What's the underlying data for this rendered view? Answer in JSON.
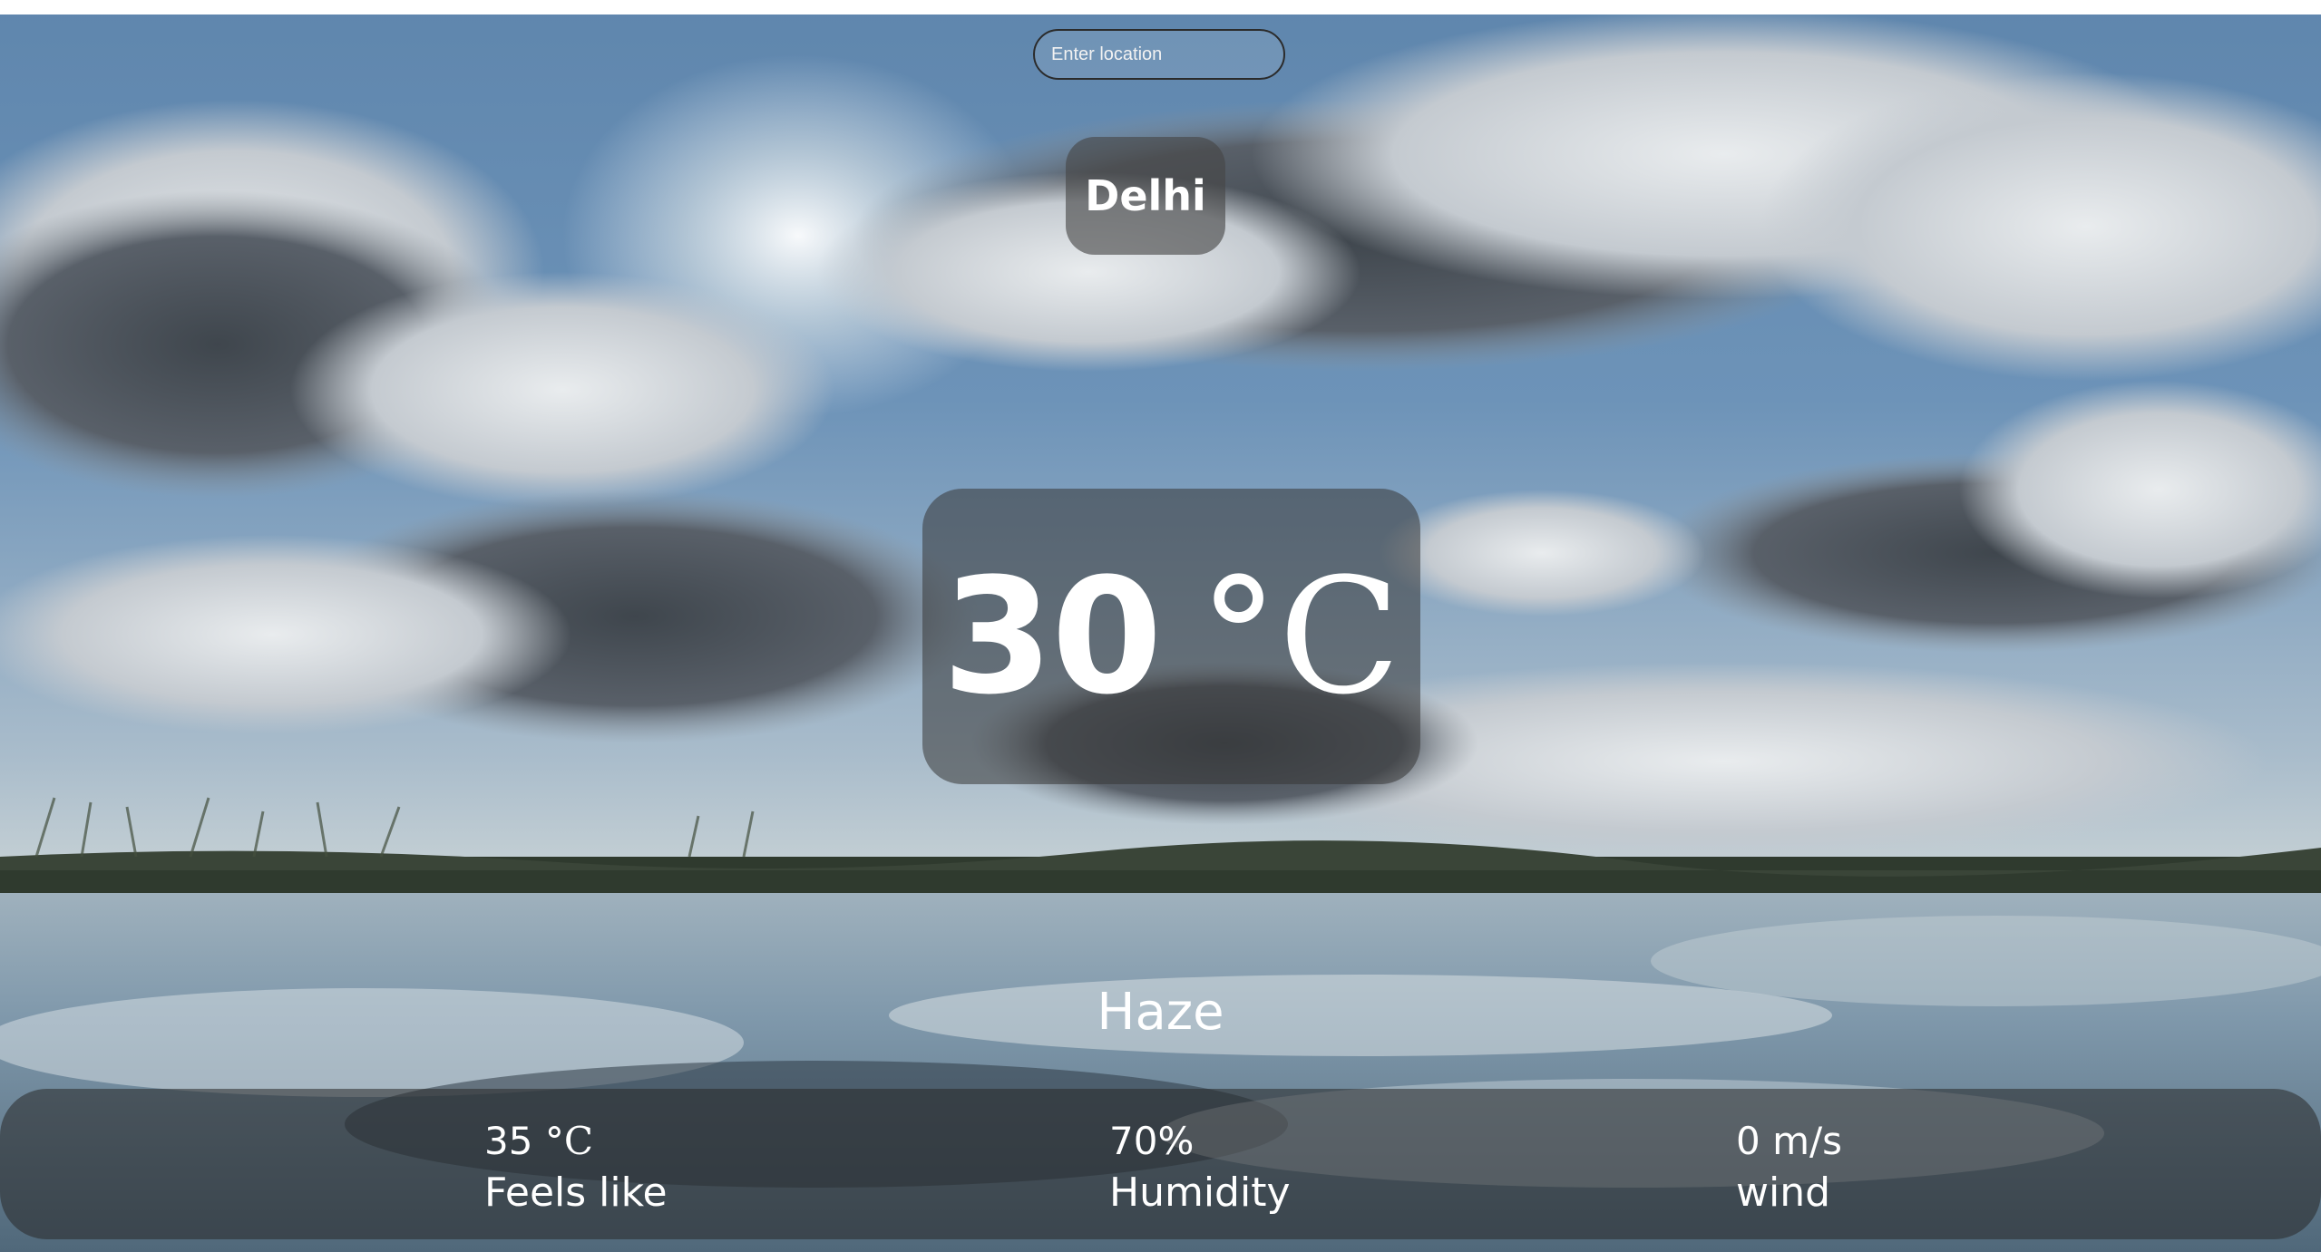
{
  "search": {
    "placeholder": "Enter location"
  },
  "location": {
    "city": "Delhi"
  },
  "current": {
    "temperature": "30",
    "temperature_unit": "°C",
    "condition": "Haze"
  },
  "details": {
    "feels_like": {
      "value": "35",
      "unit": "°C",
      "label": "Feels like"
    },
    "humidity": {
      "value": "70%",
      "label": "Humidity"
    },
    "wind": {
      "value": "0 m/s",
      "label": "wind"
    }
  }
}
